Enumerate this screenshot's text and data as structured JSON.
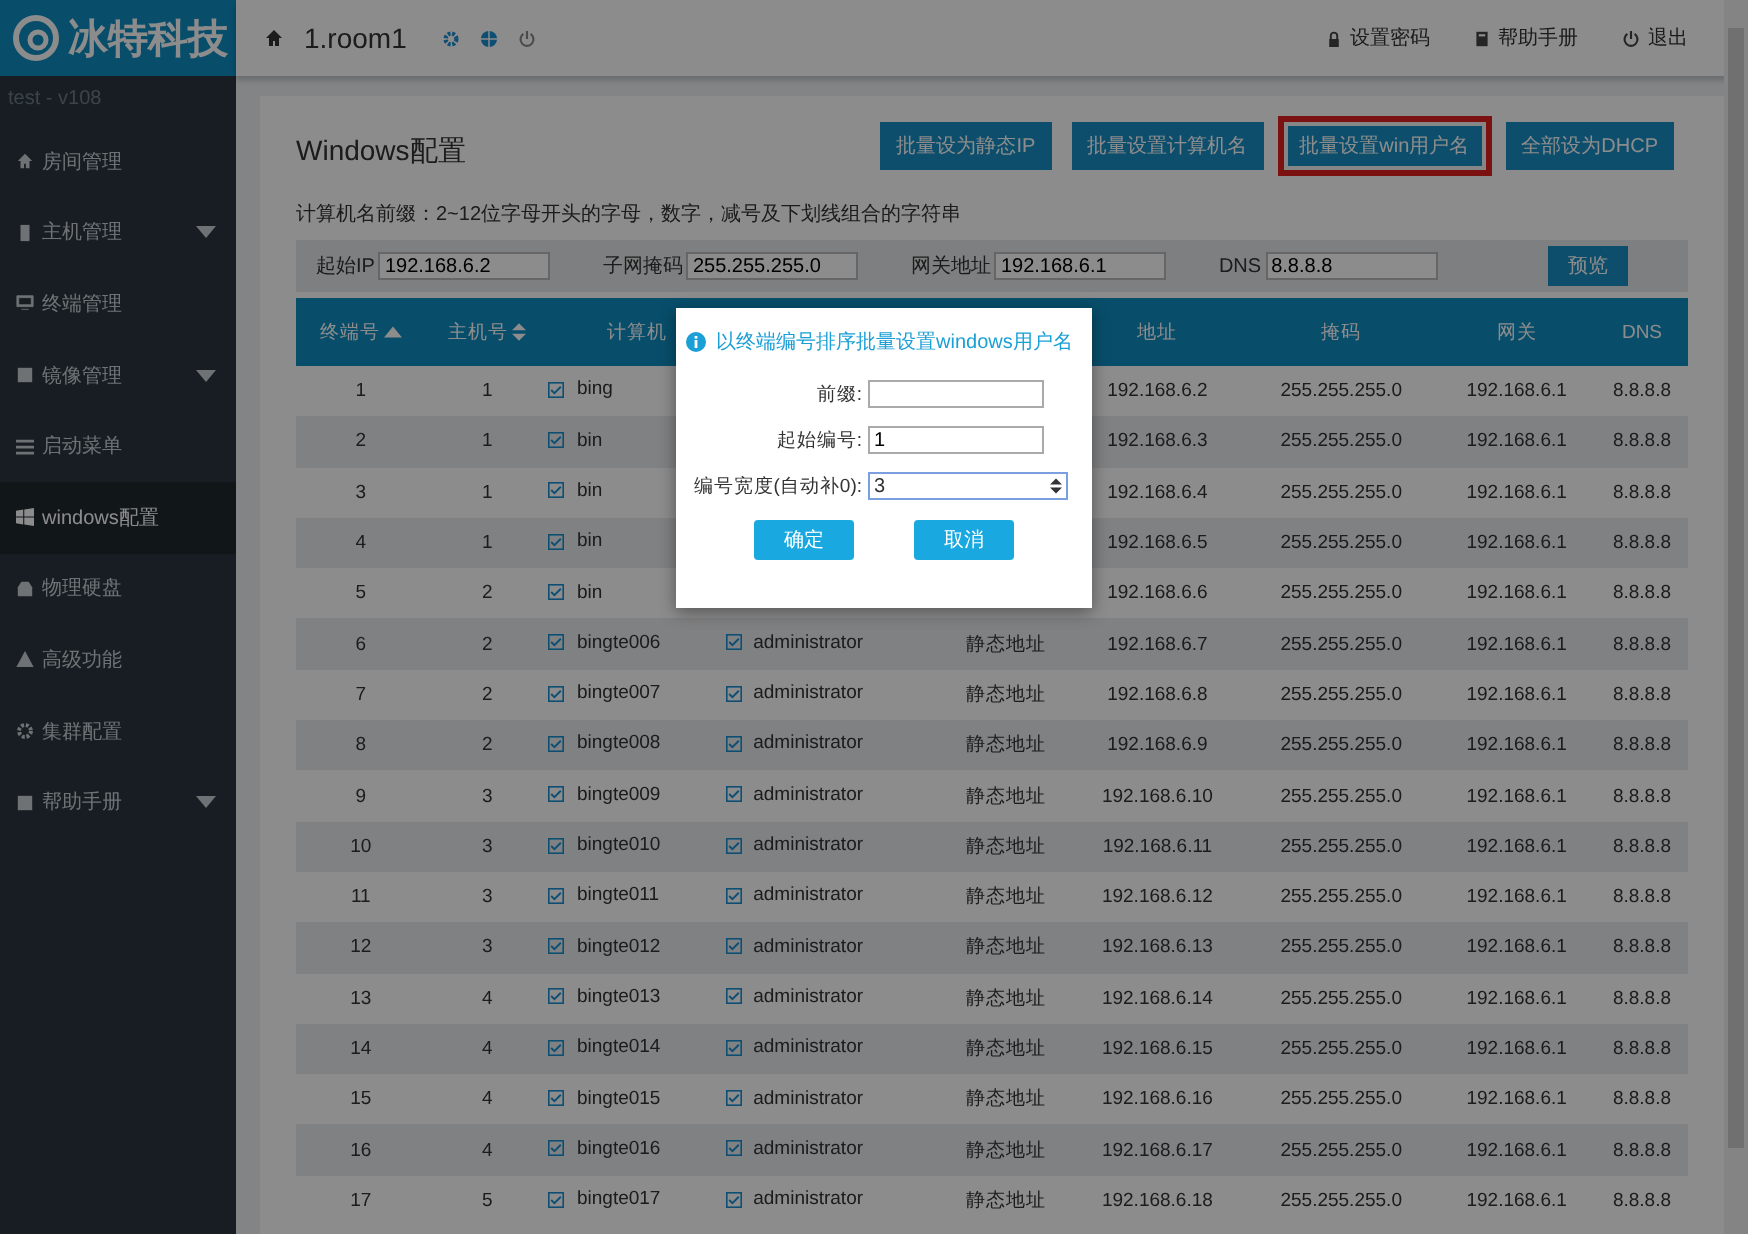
{
  "brand": {
    "name": "冰特科技",
    "version": "test - v108"
  },
  "topbar": {
    "room": "1.room1",
    "links": [
      {
        "kind": "lock",
        "label": "设置密码"
      },
      {
        "kind": "book",
        "label": "帮助手册"
      },
      {
        "kind": "power",
        "label": "退出"
      }
    ]
  },
  "sidebar": {
    "items": [
      {
        "kind": "home",
        "label": "房间管理",
        "expandable": false,
        "selected": false
      },
      {
        "kind": "host",
        "label": "主机管理",
        "expandable": true,
        "selected": false
      },
      {
        "kind": "monitor",
        "label": "终端管理",
        "expandable": false,
        "selected": false
      },
      {
        "kind": "disk",
        "label": "镜像管理",
        "expandable": true,
        "selected": false
      },
      {
        "kind": "list",
        "label": "启动菜单",
        "expandable": false,
        "selected": false
      },
      {
        "kind": "windows",
        "label": "windows配置",
        "expandable": false,
        "selected": true
      },
      {
        "kind": "drive",
        "label": "物理硬盘",
        "expandable": false,
        "selected": false
      },
      {
        "kind": "warning",
        "label": "高级功能",
        "expandable": false,
        "selected": false
      },
      {
        "kind": "gear",
        "label": "集群配置",
        "expandable": false,
        "selected": false
      },
      {
        "kind": "book",
        "label": "帮助手册",
        "expandable": true,
        "selected": false
      }
    ]
  },
  "page": {
    "title": "Windows配置",
    "hint": "计算机名前缀：2~12位字母开头的字母，数字，减号及下划线组合的字符串",
    "actions": [
      {
        "label": "批量设为静态IP",
        "highlighted": false
      },
      {
        "label": "批量设置计算机名",
        "highlighted": false
      },
      {
        "label": "批量设置win用户名",
        "highlighted": true
      },
      {
        "label": "全部设为DHCP",
        "highlighted": false
      }
    ],
    "filters": [
      {
        "label": "起始IP",
        "value": "192.168.6.2"
      },
      {
        "label": "子网掩码",
        "value": "255.255.255.0"
      },
      {
        "label": "网关地址",
        "value": "192.168.6.1"
      },
      {
        "label": "DNS",
        "value": "8.8.8.8"
      }
    ],
    "preview_button": "预览"
  },
  "table": {
    "columns": [
      {
        "label": "终端号",
        "kind": "sorted-asc"
      },
      {
        "label": "主机号",
        "kind": "sortable"
      },
      {
        "label": "计算机",
        "kind": "plain"
      },
      {
        "kind": "plain"
      },
      {
        "kind": "plain"
      },
      {
        "label": "地址",
        "kind": "plain"
      },
      {
        "label": "掩码",
        "kind": "plain"
      },
      {
        "label": "网关",
        "kind": "plain"
      },
      {
        "label": "DNS",
        "kind": "plain"
      }
    ],
    "rows": [
      {
        "no": "1",
        "host": "1",
        "name": "bing",
        "ip": "192.168.6.2",
        "mask": "255.255.255.0",
        "gw": "192.168.6.1",
        "dns": "8.8.8.8"
      },
      {
        "no": "2",
        "host": "1",
        "name": "bin",
        "ip": "192.168.6.3",
        "mask": "255.255.255.0",
        "gw": "192.168.6.1",
        "dns": "8.8.8.8"
      },
      {
        "no": "3",
        "host": "1",
        "name": "bin",
        "ip": "192.168.6.4",
        "mask": "255.255.255.0",
        "gw": "192.168.6.1",
        "dns": "8.8.8.8"
      },
      {
        "no": "4",
        "host": "1",
        "name": "bin",
        "ip": "192.168.6.5",
        "mask": "255.255.255.0",
        "gw": "192.168.6.1",
        "dns": "8.8.8.8"
      },
      {
        "no": "5",
        "host": "2",
        "name": "bin",
        "ip": "192.168.6.6",
        "mask": "255.255.255.0",
        "gw": "192.168.6.1",
        "dns": "8.8.8.8"
      },
      {
        "no": "6",
        "host": "2",
        "name": "bingte006",
        "user": "administrator",
        "type": "静态地址",
        "ip": "192.168.6.7",
        "mask": "255.255.255.0",
        "gw": "192.168.6.1",
        "dns": "8.8.8.8"
      },
      {
        "no": "7",
        "host": "2",
        "name": "bingte007",
        "user": "administrator",
        "type": "静态地址",
        "ip": "192.168.6.8",
        "mask": "255.255.255.0",
        "gw": "192.168.6.1",
        "dns": "8.8.8.8"
      },
      {
        "no": "8",
        "host": "2",
        "name": "bingte008",
        "user": "administrator",
        "type": "静态地址",
        "ip": "192.168.6.9",
        "mask": "255.255.255.0",
        "gw": "192.168.6.1",
        "dns": "8.8.8.8"
      },
      {
        "no": "9",
        "host": "3",
        "name": "bingte009",
        "user": "administrator",
        "type": "静态地址",
        "ip": "192.168.6.10",
        "mask": "255.255.255.0",
        "gw": "192.168.6.1",
        "dns": "8.8.8.8"
      },
      {
        "no": "10",
        "host": "3",
        "name": "bingte010",
        "user": "administrator",
        "type": "静态地址",
        "ip": "192.168.6.11",
        "mask": "255.255.255.0",
        "gw": "192.168.6.1",
        "dns": "8.8.8.8"
      },
      {
        "no": "11",
        "host": "3",
        "name": "bingte011",
        "user": "administrator",
        "type": "静态地址",
        "ip": "192.168.6.12",
        "mask": "255.255.255.0",
        "gw": "192.168.6.1",
        "dns": "8.8.8.8"
      },
      {
        "no": "12",
        "host": "3",
        "name": "bingte012",
        "user": "administrator",
        "type": "静态地址",
        "ip": "192.168.6.13",
        "mask": "255.255.255.0",
        "gw": "192.168.6.1",
        "dns": "8.8.8.8"
      },
      {
        "no": "13",
        "host": "4",
        "name": "bingte013",
        "user": "administrator",
        "type": "静态地址",
        "ip": "192.168.6.14",
        "mask": "255.255.255.0",
        "gw": "192.168.6.1",
        "dns": "8.8.8.8"
      },
      {
        "no": "14",
        "host": "4",
        "name": "bingte014",
        "user": "administrator",
        "type": "静态地址",
        "ip": "192.168.6.15",
        "mask": "255.255.255.0",
        "gw": "192.168.6.1",
        "dns": "8.8.8.8"
      },
      {
        "no": "15",
        "host": "4",
        "name": "bingte015",
        "user": "administrator",
        "type": "静态地址",
        "ip": "192.168.6.16",
        "mask": "255.255.255.0",
        "gw": "192.168.6.1",
        "dns": "8.8.8.8"
      },
      {
        "no": "16",
        "host": "4",
        "name": "bingte016",
        "user": "administrator",
        "type": "静态地址",
        "ip": "192.168.6.17",
        "mask": "255.255.255.0",
        "gw": "192.168.6.1",
        "dns": "8.8.8.8"
      },
      {
        "no": "17",
        "host": "5",
        "name": "bingte017",
        "user": "administrator",
        "type": "静态地址",
        "ip": "192.168.6.18",
        "mask": "255.255.255.0",
        "gw": "192.168.6.1",
        "dns": "8.8.8.8"
      }
    ]
  },
  "dialog": {
    "title": "以终端编号排序批量设置windows用户名",
    "fields": [
      {
        "label": "前缀:",
        "kind": "text"
      },
      {
        "label": "起始编号:",
        "value": "1",
        "kind": "text"
      },
      {
        "label": "编号宽度(自动补0):",
        "value": "3",
        "kind": "number"
      }
    ],
    "buttons": [
      "确定",
      "取消"
    ]
  }
}
